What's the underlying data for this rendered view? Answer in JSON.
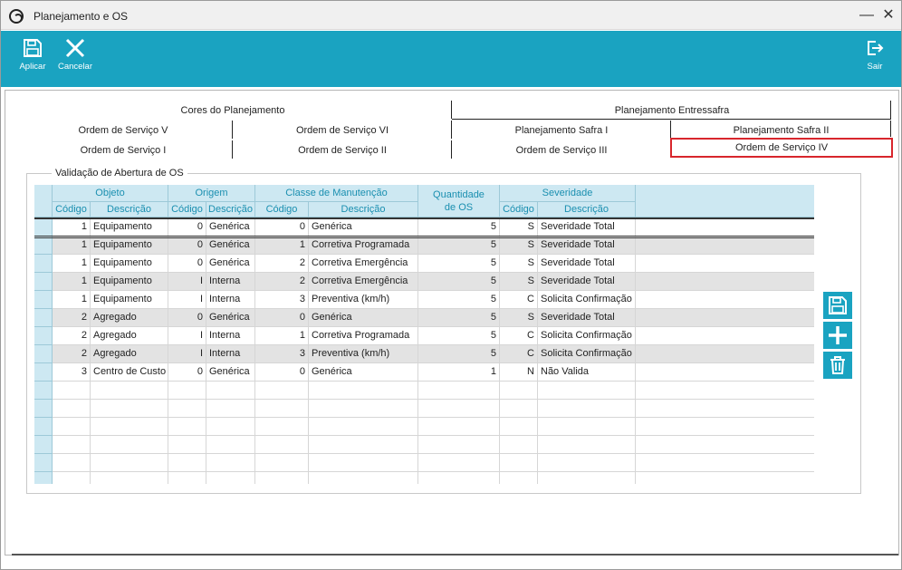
{
  "window": {
    "title": "Planejamento e OS",
    "minimize": "—",
    "close": "✕"
  },
  "toolbar": {
    "apply_label": "Aplicar",
    "cancel_label": "Cancelar",
    "exit_label": "Sair",
    "color": "#1aa3c1"
  },
  "tabs": {
    "row1": [
      "Cores do Planejamento",
      "Planejamento Entressafra"
    ],
    "row2": [
      "Ordem de Serviço V",
      "Ordem de Serviço VI",
      "Planejamento Safra I",
      "Planejamento Safra II"
    ],
    "row3": [
      "Ordem de Serviço I",
      "Ordem de Serviço II",
      "Ordem de Serviço III",
      "Ordem de Serviço IV"
    ],
    "selected": "Ordem de Serviço IV"
  },
  "group": {
    "title": "Validação de Abertura de OS"
  },
  "grid": {
    "groups": [
      "Objeto",
      "Origem",
      "Classe de Manutenção",
      "Quantidade de OS",
      "Severidade"
    ],
    "columns": [
      "Código",
      "Descrição",
      "Código",
      "Descrição",
      "Código",
      "Descrição",
      "Código",
      "Descrição"
    ],
    "rows": [
      [
        "1",
        "Equipamento",
        "0",
        "Genérica",
        "0",
        "Genérica",
        "5",
        "S",
        "Severidade Total"
      ],
      [
        "1",
        "Equipamento",
        "0",
        "Genérica",
        "1",
        "Corretiva Programada",
        "5",
        "S",
        "Severidade Total"
      ],
      [
        "1",
        "Equipamento",
        "0",
        "Genérica",
        "2",
        "Corretiva Emergência",
        "5",
        "S",
        "Severidade Total"
      ],
      [
        "1",
        "Equipamento",
        "I",
        "Interna",
        "2",
        "Corretiva Emergência",
        "5",
        "S",
        "Severidade Total"
      ],
      [
        "1",
        "Equipamento",
        "I",
        "Interna",
        "3",
        "Preventiva (km/h)",
        "5",
        "C",
        "Solicita Confirmação"
      ],
      [
        "2",
        "Agregado",
        "0",
        "Genérica",
        "0",
        "Genérica",
        "5",
        "S",
        "Severidade Total"
      ],
      [
        "2",
        "Agregado",
        "I",
        "Interna",
        "1",
        "Corretiva Programada",
        "5",
        "C",
        "Solicita Confirmação"
      ],
      [
        "2",
        "Agregado",
        "I",
        "Interna",
        "3",
        "Preventiva (km/h)",
        "5",
        "C",
        "Solicita Confirmação"
      ],
      [
        "3",
        "Centro de Custo",
        "0",
        "Genérica",
        "0",
        "Genérica",
        "1",
        "N",
        "Não Valida"
      ]
    ],
    "header_color": "#cde8f2",
    "header_text_color": "#1a8fb0",
    "alt_row_color": "#e3e3e3"
  },
  "side_actions": [
    "save-icon",
    "plus-icon",
    "trash-icon"
  ],
  "selected_tab_border_color": "#d8262c"
}
